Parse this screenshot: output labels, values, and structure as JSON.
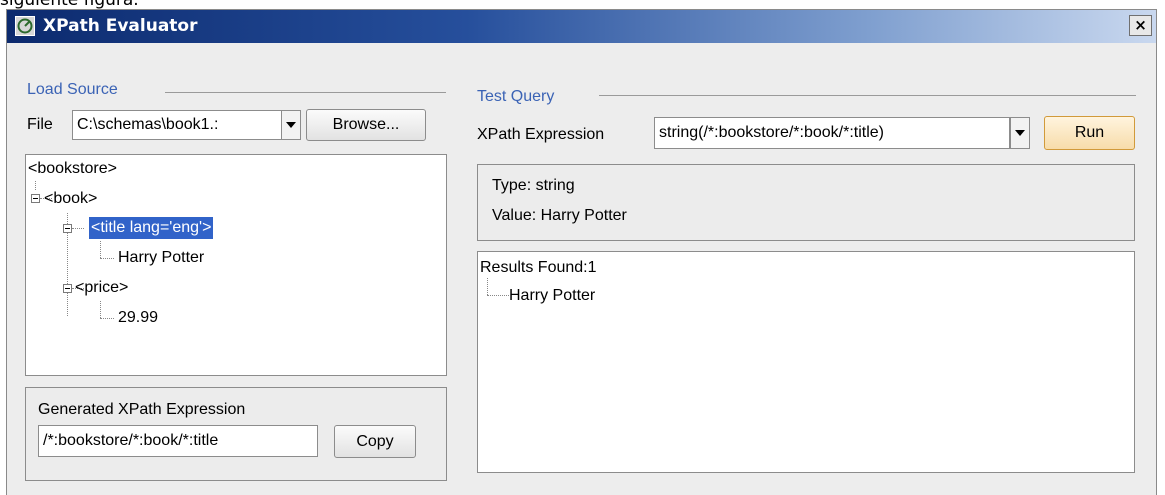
{
  "document": {
    "text_above": "siguiente figura."
  },
  "window": {
    "title": "XPath Evaluator",
    "close_label": "×"
  },
  "load_source": {
    "group_title": "Load Source",
    "file_label": "File",
    "file_value": "C:\\schemas\\book1.:",
    "browse_label": "Browse...",
    "tree": {
      "root": "<bookstore>",
      "book": "<book>",
      "title_node": "<title lang='eng'>",
      "title_value": "Harry Potter",
      "price_node": "<price>",
      "price_value": "29.99"
    }
  },
  "generated_xpath": {
    "group_title": "Generated XPath Expression",
    "value": "/*:bookstore/*:book/*:title",
    "copy_label": "Copy"
  },
  "test_query": {
    "group_title": "Test Query",
    "expression_label": "XPath Expression",
    "expression_value": "string(/*:bookstore/*:book/*:title)",
    "run_label": "Run",
    "type_text": "Type: string",
    "value_text": "Value: Harry Potter",
    "results_header": "Results Found:1",
    "results": [
      "Harry Potter"
    ]
  },
  "colors": {
    "titlebar_start": "#0c2a6e",
    "selection": "#3163c9",
    "group_title": "#3b63b5",
    "run_button": "#f7dcaa"
  },
  "icons": {
    "app": "xpath-evaluator-app-icon",
    "close": "close-icon",
    "combo": "chevron-down-icon",
    "tree_expander": "tree-collapse-icon"
  }
}
